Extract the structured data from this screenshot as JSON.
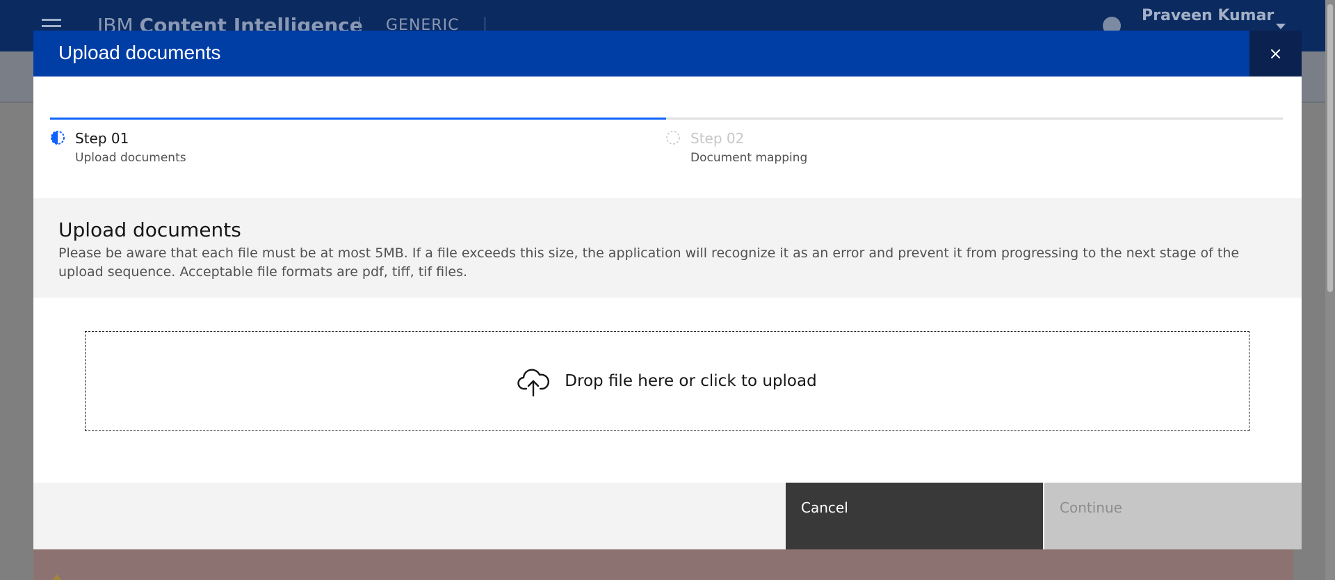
{
  "app": {
    "title_prefix": "IBM",
    "title_main": "Content Intelligence",
    "workspace": "GENERIC",
    "user_name": "Praveen Kumar"
  },
  "modal": {
    "title": "Upload documents",
    "close_label": "×",
    "steps": [
      {
        "number": "Step 01",
        "description": "Upload documents",
        "state": "current"
      },
      {
        "number": "Step 02",
        "description": "Document mapping",
        "state": "incomplete"
      }
    ],
    "progress_fraction": 0.5,
    "info": {
      "heading": "Upload documents",
      "text": "Please be aware that each file must be at most 5MB. If a file exceeds this size, the application will recognize it as an error and prevent it from progressing to the next stage of the upload sequence. Acceptable file formats are pdf, tiff, tif files."
    },
    "dropzone": {
      "icon": "cloud-upload-icon",
      "label": "Drop file here or click to upload"
    },
    "footer": {
      "cancel_label": "Cancel",
      "continue_label": "Continue"
    }
  },
  "colors": {
    "modal_header": "#003da5",
    "close_button": "#0b2150",
    "step_active": "#0f62fe",
    "cancel_button": "#393939",
    "continue_disabled": "#c6c6c6"
  }
}
